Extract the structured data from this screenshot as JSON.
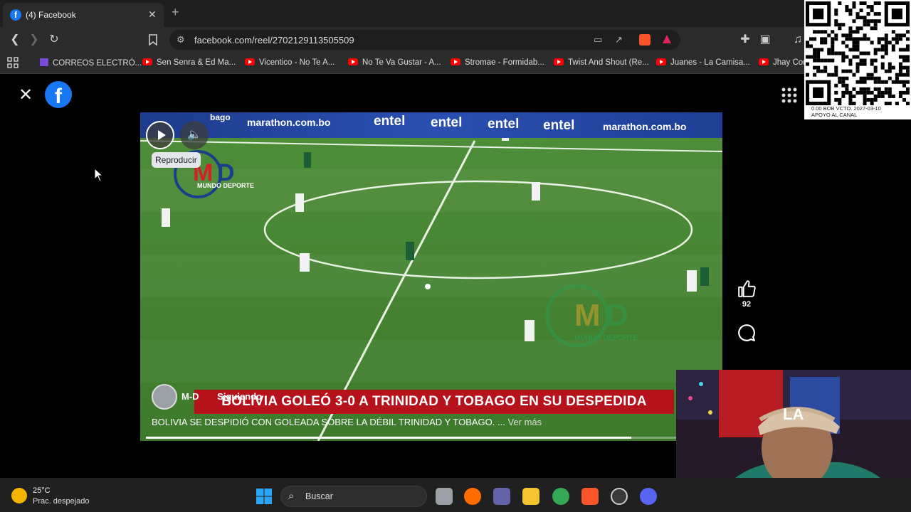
{
  "browser": {
    "tab_title": "(4) Facebook",
    "tab_favicon": "f",
    "url": "facebook.com/reel/2702129113505509",
    "bookmarks": [
      {
        "label": "CORREOS ELECTRÓ...",
        "icon": "playlist-icon"
      },
      {
        "label": "Sen Senra & Ed Ma...",
        "icon": "youtube-icon"
      },
      {
        "label": "Vicentico - No Te A...",
        "icon": "youtube-icon"
      },
      {
        "label": "No Te Va Gustar - A...",
        "icon": "youtube-icon"
      },
      {
        "label": "Stromae - Formidab...",
        "icon": "youtube-icon"
      },
      {
        "label": "Twist And Shout (Re...",
        "icon": "youtube-icon"
      },
      {
        "label": "Juanes - La Camisa...",
        "icon": "youtube-icon"
      },
      {
        "label": "Jhay Cort",
        "icon": "youtube-icon"
      }
    ]
  },
  "reel": {
    "tooltip": "Reproducir",
    "author": "M-D",
    "follow_status": "Siguiendo",
    "headline": "BOLIVIA GOLEÓ 3-0 A TRINIDAD Y TOBAGO EN SU DESPEDIDA",
    "caption": "BOLIVIA SE DESPIDIÓ CON GOLEADA SOBRE LA DÉBIL TRINIDAD Y TOBAGO. ...",
    "see_more": "Ver más",
    "likes": "92",
    "progress": 0.85,
    "watermark": "MUNDO DEPORTE",
    "ads": [
      "marathon.com.bo",
      "entel",
      "entel",
      "entel",
      "entel",
      "marathon.com.bo",
      "bago"
    ]
  },
  "overlay_qr": {
    "line1": "0.00 BOB   VCTO. 2027-03-10",
    "line2": "APOYO AL CANAL"
  },
  "taskbar": {
    "temperature": "25°C",
    "condition": "Prac. despejado",
    "search_placeholder": "Buscar"
  },
  "colors": {
    "facebook_blue": "#1877f2",
    "headline_red": "#b5121b",
    "pitch_green": "#4a8a36"
  }
}
